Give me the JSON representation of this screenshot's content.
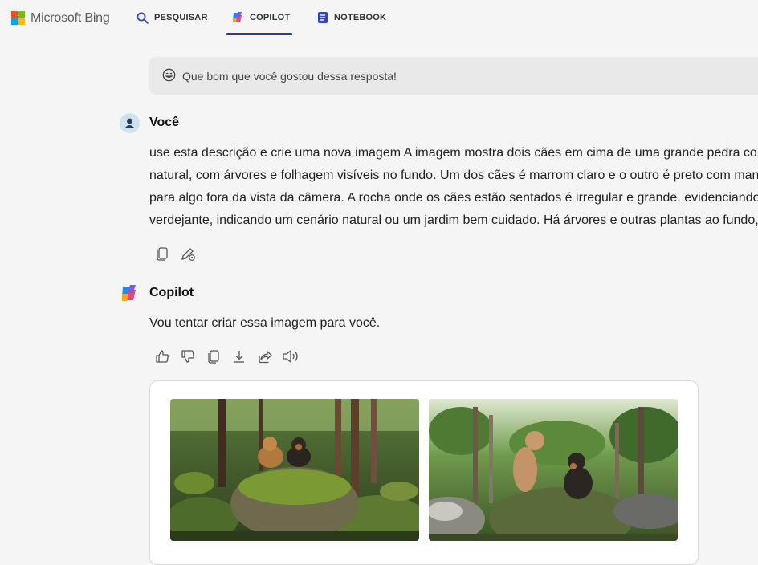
{
  "brand": {
    "name": "Microsoft Bing"
  },
  "nav": {
    "tabs": [
      {
        "label": "PESQUISAR",
        "icon": "search-icon",
        "active": false
      },
      {
        "label": "COPILOT",
        "icon": "copilot-icon",
        "active": true
      },
      {
        "label": "NOTEBOOK",
        "icon": "notebook-icon",
        "active": false
      }
    ]
  },
  "feedback": {
    "text": "Que bom que você gostou dessa resposta!",
    "icon": "smile-icon"
  },
  "user_message": {
    "speaker": "Você",
    "lines": [
      "use esta descrição e crie uma nova imagem A imagem mostra dois cães em cima de uma grande pedra col",
      "natural, com árvores e folhagem visíveis no fundo. Um dos cães é marrom claro e o outro é preto com manc",
      "para algo fora da vista da câmera. A rocha onde os cães estão sentados é irregular e grande, evidenciando",
      "verdejante, indicando um cenário natural ou um jardim bem cuidado. Há árvores e outras plantas ao fundo,"
    ],
    "actions": [
      "copy-icon",
      "edit-icon"
    ]
  },
  "copilot_message": {
    "speaker": "Copilot",
    "text": "Vou tentar criar essa imagem para você.",
    "actions": [
      "thumbs-up-icon",
      "thumbs-down-icon",
      "copy-icon",
      "download-icon",
      "share-icon",
      "read-aloud-icon"
    ]
  },
  "generated_images": [
    {
      "subject": "two dogs on mossy boulder in forest"
    },
    {
      "subject": "two dogs on mossy rock in jungle"
    }
  ],
  "colors": {
    "accent": "#2a3c9a",
    "background": "#f5f5f5",
    "feedback_bg": "#e9e9e9"
  }
}
